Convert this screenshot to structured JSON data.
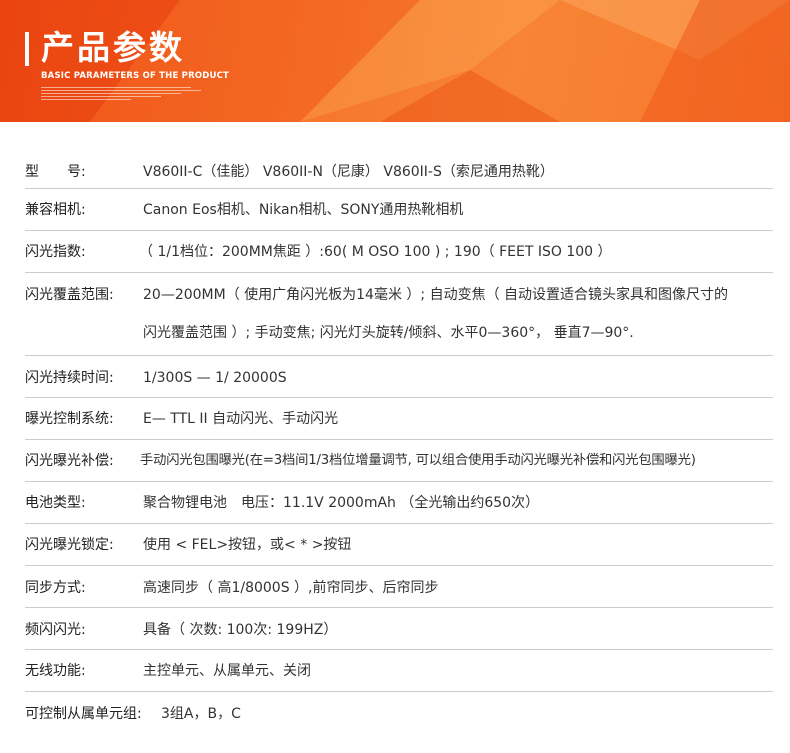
{
  "header": {
    "title": "产品参数",
    "subtitle": "BASIC PARAMETERS OF THE PRODUCT"
  },
  "colors": {
    "banner": "#f05a1c",
    "divider": "#cccccc"
  },
  "specs": [
    {
      "label": "型　　号:",
      "value": "V860II-C（佳能） V860II-N（尼康） V860II-S（索尼通用热靴）"
    },
    {
      "label": "兼容相机:",
      "value": "Canon Eos相机、Nikan相机、SONY通用热靴相机"
    },
    {
      "label": "闪光指数:",
      "value": "（ 1/1档位：200MM焦距 ）:60( M OSO 100 ) ; 190（ FEET ISO 100 ）"
    },
    {
      "label": "闪光覆盖范围:",
      "value": "20—200MM（ 使用广角闪光板为14毫米 ）; 自动变焦（ 自动设置适合镜头家具和图像尺寸的",
      "value2": "闪光覆盖范围 ）; 手动变焦; 闪光灯头旋转/倾斜、水平0—360°， 垂直7—90°."
    },
    {
      "label": "闪光持续时间:",
      "value": "1/300S — 1/ 20000S"
    },
    {
      "label": "曝光控制系统:",
      "value": "E— TTL II 自动闪光、手动闪光"
    },
    {
      "label": "闪光曝光补偿:",
      "value": "手动闪光包围曝光(在=3档间1/3档位增量调节, 可以组合使用手动闪光曝光补偿和闪光包围曝光)"
    },
    {
      "label": "电池类型:",
      "value": "聚合物锂电池　电压：11.1V 2000mAh （全光输出约650次）"
    },
    {
      "label": "闪光曝光锁定:",
      "value": "使用 < FEL>按钮，或< * >按钮"
    },
    {
      "label": "同步方式:",
      "value": "高速同步（ 高1/8000S ）,前帘同步、后帘同步"
    },
    {
      "label": "频闪闪光:",
      "value": "具备（ 次数: 100次: 199HZ）"
    },
    {
      "label": "无线功能:",
      "value": "主控单元、从属单元、关闭"
    },
    {
      "label": "可控制从属单元组:",
      "value": "3组A，B，C"
    }
  ]
}
